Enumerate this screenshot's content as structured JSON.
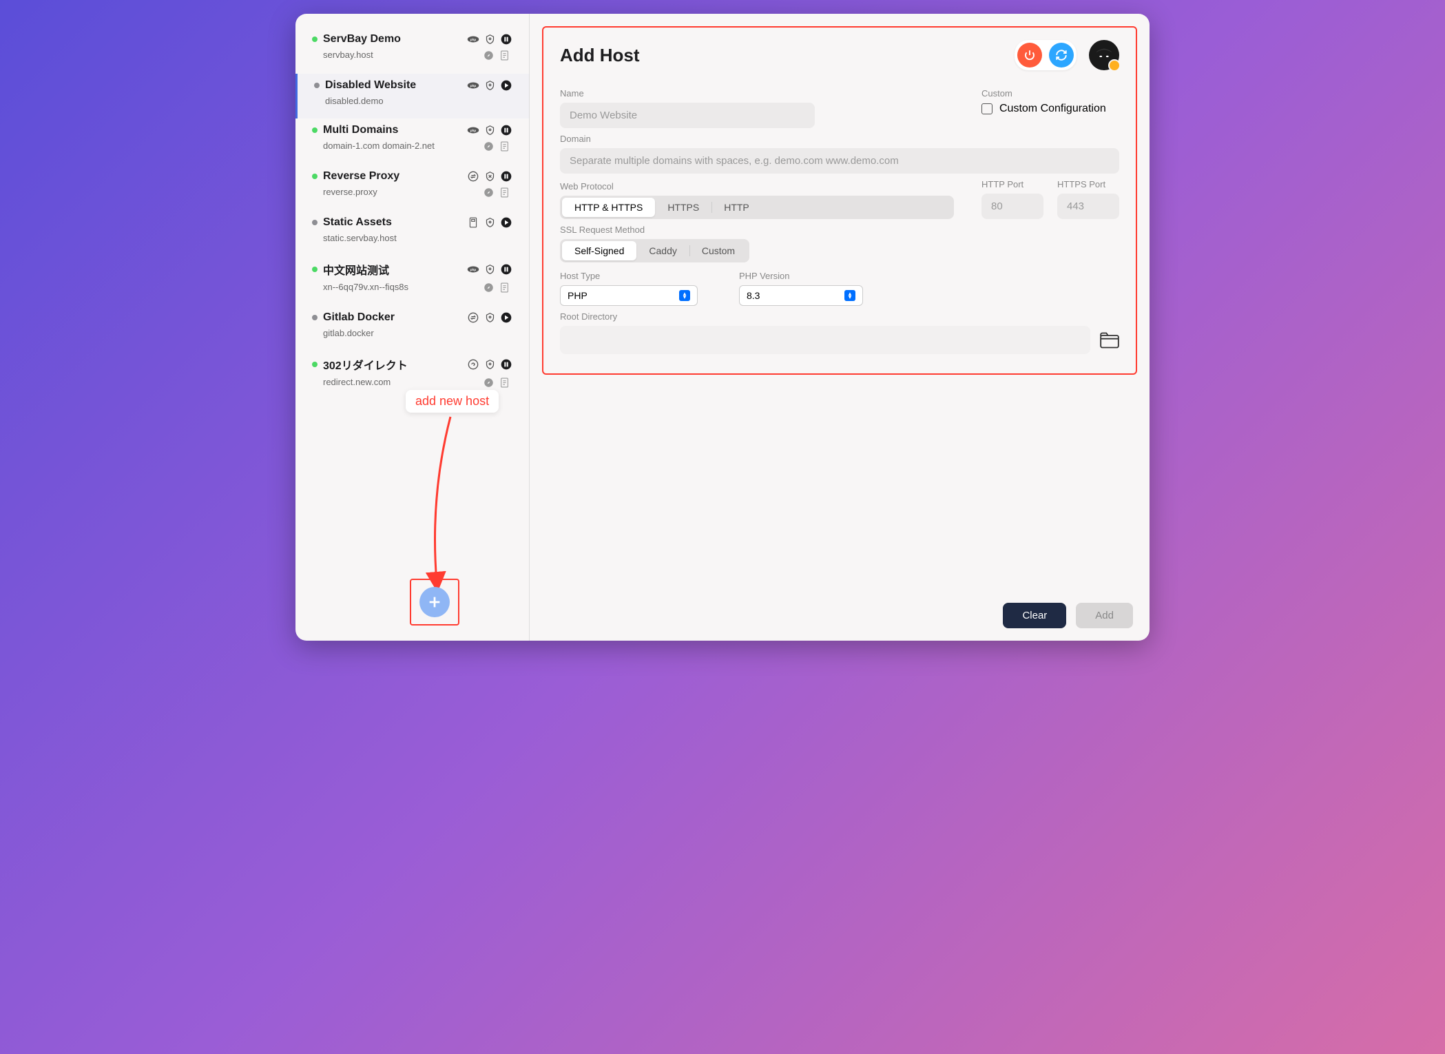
{
  "sidebar": {
    "items": [
      {
        "name": "ServBay Demo",
        "domain": "servbay.host",
        "status": "green",
        "icons": [
          "php",
          "shield",
          "pause"
        ],
        "sub": [
          "compass",
          "doc"
        ]
      },
      {
        "name": "Disabled Website",
        "domain": "disabled.demo",
        "status": "gray",
        "icons": [
          "php",
          "shield",
          "play"
        ],
        "sub": [],
        "selected": true
      },
      {
        "name": "Multi Domains",
        "domain": "domain-1.com domain-2.net",
        "status": "green",
        "icons": [
          "php",
          "shield",
          "pause"
        ],
        "sub": [
          "compass",
          "doc"
        ]
      },
      {
        "name": "Reverse Proxy",
        "domain": "reverse.proxy",
        "status": "green",
        "icons": [
          "swap",
          "shield-x",
          "pause"
        ],
        "sub": [
          "compass",
          "doc"
        ]
      },
      {
        "name": "Static Assets",
        "domain": "static.servbay.host",
        "status": "gray",
        "icons": [
          "static",
          "shield",
          "play"
        ],
        "sub": []
      },
      {
        "name": "中文网站测试",
        "domain": "xn--6qq79v.xn--fiqs8s",
        "status": "green",
        "icons": [
          "php",
          "shield",
          "pause"
        ],
        "sub": [
          "compass",
          "doc"
        ]
      },
      {
        "name": "Gitlab Docker",
        "domain": "gitlab.docker",
        "status": "gray",
        "icons": [
          "swap",
          "shield",
          "play"
        ],
        "sub": []
      },
      {
        "name": "302リダイレクト",
        "domain": "redirect.new.com",
        "status": "green",
        "icons": [
          "redirect",
          "shield",
          "pause"
        ],
        "sub": [
          "compass",
          "doc"
        ]
      }
    ]
  },
  "callout": "add new host",
  "main": {
    "title": "Add Host",
    "labels": {
      "name": "Name",
      "domain": "Domain",
      "web_protocol": "Web Protocol",
      "http_port": "HTTP Port",
      "https_port": "HTTPS Port",
      "ssl": "SSL Request Method",
      "host_type": "Host Type",
      "php_version": "PHP Version",
      "root": "Root Directory",
      "custom": "Custom"
    },
    "placeholders": {
      "name": "Demo Website",
      "domain": "Separate multiple domains with spaces, e.g. demo.com www.demo.com",
      "http_port": "80",
      "https_port": "443"
    },
    "protocol": {
      "options": [
        "HTTP & HTTPS",
        "HTTPS",
        "HTTP"
      ],
      "active": 0
    },
    "ssl": {
      "options": [
        "Self-Signed",
        "Caddy",
        "Custom"
      ],
      "active": 0
    },
    "host_type": "PHP",
    "php_version": "8.3",
    "custom_config": "Custom Configuration"
  },
  "footer": {
    "clear": "Clear",
    "add": "Add"
  }
}
